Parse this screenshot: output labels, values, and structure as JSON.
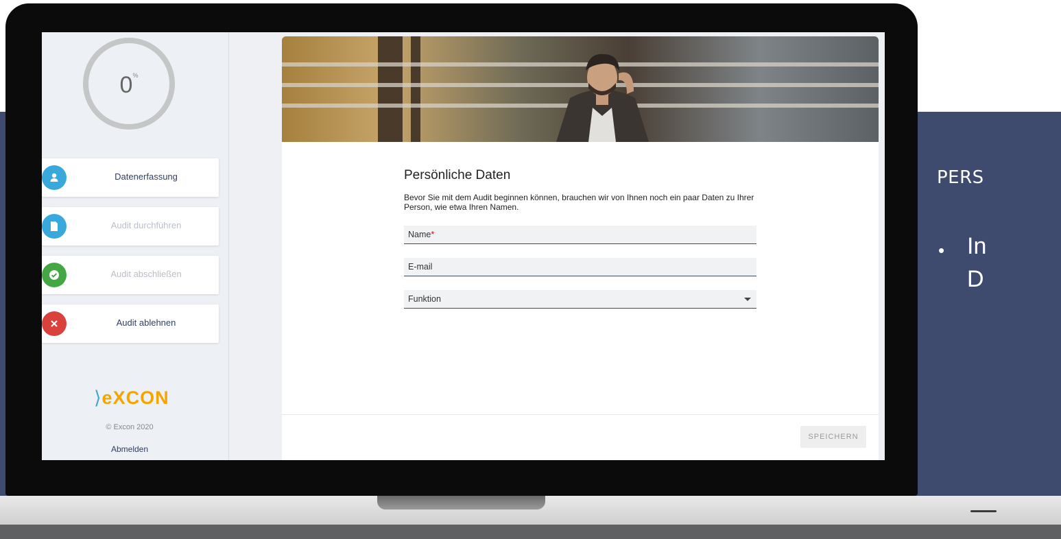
{
  "slide": {
    "title": "PERS",
    "bullet": "•",
    "text_line1": "In",
    "text_line2": "D"
  },
  "progress": {
    "value": "0",
    "unit": "%"
  },
  "steps": [
    {
      "label": "Datenerfassung",
      "icon": "user-icon",
      "color": "#39a9dc",
      "active": true
    },
    {
      "label": "Audit durchführen",
      "icon": "document-icon",
      "color": "#39a9dc",
      "active": false
    },
    {
      "label": "Audit abschließen",
      "icon": "check-icon",
      "color": "#43a843",
      "active": false
    },
    {
      "label": "Audit ablehnen",
      "icon": "close-icon",
      "color": "#d9413d",
      "active": true
    }
  ],
  "brand": {
    "logo_chevron": "⟩",
    "logo_text": "eXCON",
    "copyright": "© Excon 2020",
    "logout": "Abmelden"
  },
  "form": {
    "title": "Persönliche Daten",
    "description": "Bevor Sie mit dem Audit beginnen können, brauchen wir von Ihnen noch ein paar Daten zu Ihrer Person, wie etwa Ihren Namen.",
    "fields": [
      {
        "label": "Name",
        "required_mark": "*"
      },
      {
        "label": "E-mail"
      },
      {
        "label": "Funktion"
      }
    ],
    "save_label": "SPEICHERN"
  },
  "colors": {
    "slide_bg": "#3e4b6f",
    "nav_text": "#2e3f62",
    "logo": "#f5a500"
  }
}
